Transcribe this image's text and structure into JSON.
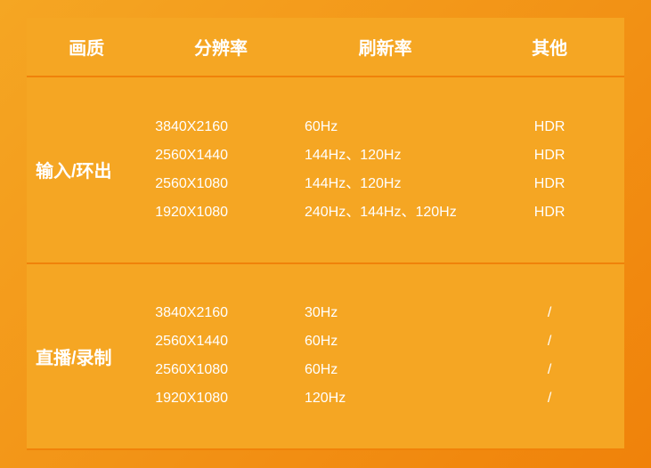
{
  "header": {
    "quality_label": "画质",
    "resolution_label": "分辨率",
    "refresh_label": "刷新率",
    "other_label": "其他"
  },
  "sections": [
    {
      "id": "input-output",
      "label": "输入/环出",
      "rows": [
        {
          "resolution": "3840X2160",
          "refresh": "60Hz",
          "other": "HDR"
        },
        {
          "resolution": "2560X1440",
          "refresh": "144Hz、120Hz",
          "other": "HDR"
        },
        {
          "resolution": "2560X1080",
          "refresh": "144Hz、120Hz",
          "other": "HDR"
        },
        {
          "resolution": "1920X1080",
          "refresh": "240Hz、144Hz、120Hz",
          "other": "HDR"
        }
      ]
    },
    {
      "id": "live-record",
      "label": "直播/录制",
      "rows": [
        {
          "resolution": "3840X2160",
          "refresh": "30Hz",
          "other": "/"
        },
        {
          "resolution": "2560X1440",
          "refresh": "60Hz",
          "other": "/"
        },
        {
          "resolution": "2560X1080",
          "refresh": "60Hz",
          "other": "/"
        },
        {
          "resolution": "1920X1080",
          "refresh": "120Hz",
          "other": "/"
        }
      ]
    }
  ],
  "accent_color": "#f5a623",
  "dark_accent": "#f0820a"
}
